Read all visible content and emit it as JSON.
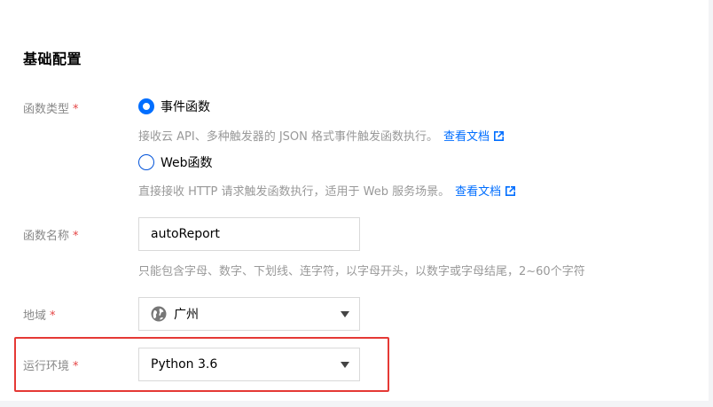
{
  "section": {
    "title": "基础配置"
  },
  "function_type": {
    "label": "函数类型",
    "required_mark": "*",
    "options": [
      {
        "label": "事件函数",
        "selected": true,
        "description": "接收云 API、多种触发器的 JSON 格式事件触发函数执行。",
        "link": "查看文档"
      },
      {
        "label": "Web函数",
        "selected": false,
        "description": "直接接收 HTTP 请求触发函数执行，适用于 Web 服务场景。",
        "link": "查看文档"
      }
    ]
  },
  "function_name": {
    "label": "函数名称",
    "required_mark": "*",
    "value": "autoReport",
    "hint": "只能包含字母、数字、下划线、连字符，以字母开头，以数字或字母结尾，2~60个字符"
  },
  "region": {
    "label": "地域",
    "required_mark": "*",
    "value": "广州",
    "icon": "globe-icon"
  },
  "runtime": {
    "label": "运行环境",
    "required_mark": "*",
    "value": "Python 3.6"
  },
  "colors": {
    "accent": "#006eff",
    "required": "#e54545",
    "highlight": "#e53935"
  }
}
